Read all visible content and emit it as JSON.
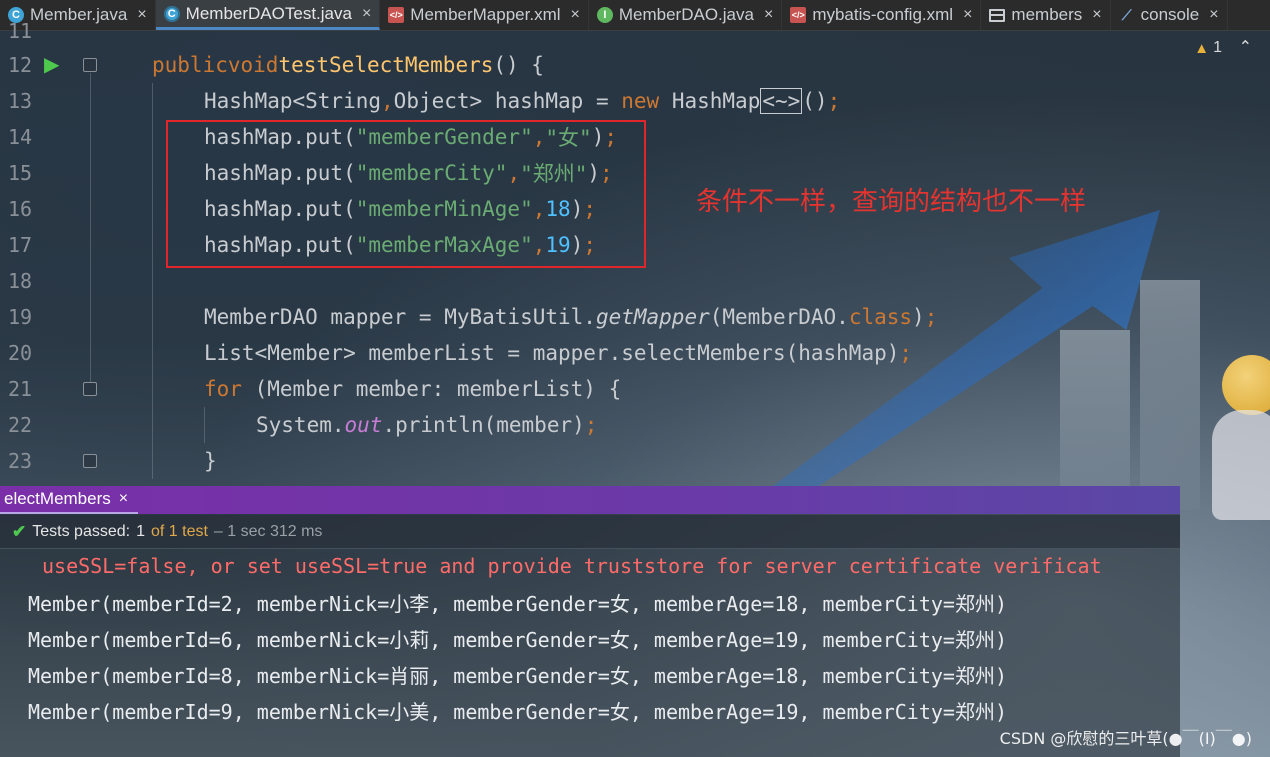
{
  "tabs": [
    {
      "label": "Member.java",
      "icon": "class-icon",
      "active": false
    },
    {
      "label": "MemberDAOTest.java",
      "icon": "test-class-icon",
      "active": true
    },
    {
      "label": "MemberMapper.xml",
      "icon": "xml-icon",
      "active": false
    },
    {
      "label": "MemberDAO.java",
      "icon": "interface-icon",
      "active": false
    },
    {
      "label": "mybatis-config.xml",
      "icon": "xml-icon",
      "active": false
    },
    {
      "label": "members",
      "icon": "table-icon",
      "active": false
    },
    {
      "label": "console",
      "icon": "console-icon",
      "active": false
    }
  ],
  "editor": {
    "warning_count": "1",
    "line_numbers": [
      "11",
      "12",
      "13",
      "14",
      "15",
      "16",
      "17",
      "18",
      "19",
      "20",
      "21",
      "22",
      "23"
    ],
    "annotation": "条件不一样，查询的结构也不一样",
    "code": {
      "l12": {
        "kw1": "public",
        "kw2": "void",
        "fn": "testSelectMembers",
        "rest": "() {"
      },
      "l13": {
        "a": "HashMap<String",
        "comma": ",",
        "b": "Object> hashMap = ",
        "kw": "new",
        "c": " HashMap",
        "diamond": "<~>",
        "d": "()",
        "semi": ";"
      },
      "l14": {
        "a": "hashMap.put(",
        "s1": "\"memberGender\"",
        "comma": ",",
        "s2": "\"女\"",
        "b": ")",
        "semi": ";"
      },
      "l15": {
        "a": "hashMap.put(",
        "s1": "\"memberCity\"",
        "comma": ",",
        "s2": "\"郑州\"",
        "b": ")",
        "semi": ";"
      },
      "l16": {
        "a": "hashMap.put(",
        "s1": "\"memberMinAge\"",
        "comma": ",",
        "n": "18",
        "b": ")",
        "semi": ";"
      },
      "l17": {
        "a": "hashMap.put(",
        "s1": "\"memberMaxAge\"",
        "comma": ",",
        "n": "19",
        "b": ")",
        "semi": ";"
      },
      "l19": {
        "a": "MemberDAO mapper = MyBatisUtil.",
        "it": "getMapper",
        "b": "(MemberDAO.",
        "kw": "class",
        "c": ")",
        "semi": ";"
      },
      "l20": {
        "a": "List<Member> memberList = mapper.selectMembers(hashMap)",
        "semi": ";"
      },
      "l21": {
        "kw": "for",
        "a": " (Member member: memberList) {"
      },
      "l22": {
        "a": "System.",
        "it": "out",
        "b": ".println(member)",
        "semi": ";"
      },
      "l23": {
        "a": "}"
      }
    }
  },
  "run_panel": {
    "tab_label": "electMembers",
    "status": {
      "label": "Tests passed:",
      "count": "1",
      "of": "of 1 test",
      "time": "– 1 sec 312 ms"
    },
    "output": [
      "useSSL=false, or set useSSL=true and provide truststore for server certificate verificat",
      "Member(memberId=2, memberNick=小李, memberGender=女, memberAge=18, memberCity=郑州)",
      "Member(memberId=6, memberNick=小莉, memberGender=女, memberAge=19, memberCity=郑州)",
      "Member(memberId=8, memberNick=肖丽, memberGender=女, memberAge=18, memberCity=郑州)",
      "Member(memberId=9, memberNick=小美, memberGender=女, memberAge=19, memberCity=郑州)"
    ]
  },
  "watermark": "CSDN @欣慰的三叶草(●￣(I)￣●)",
  "colors": {
    "keyword": "#cc7832",
    "function": "#ffc66d",
    "string": "#6aab73",
    "number": "#4fc1ff",
    "highlight_box": "#e0262b",
    "annotation": "#e3342f",
    "run_tab": "#7a2fa8",
    "pass": "#4ec94e"
  }
}
